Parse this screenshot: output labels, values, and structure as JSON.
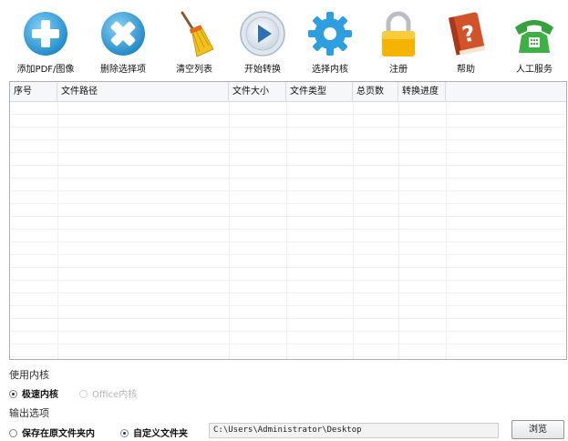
{
  "toolbar": {
    "buttons": [
      {
        "label": "添加PDF/图像",
        "icon": "add-icon"
      },
      {
        "label": "删除选择项",
        "icon": "delete-icon"
      },
      {
        "label": "清空列表",
        "icon": "broom-icon"
      },
      {
        "label": "开始转换",
        "icon": "play-icon"
      },
      {
        "label": "选择内核",
        "icon": "gear-icon"
      },
      {
        "label": "注册",
        "icon": "lock-icon"
      },
      {
        "label": "帮助",
        "icon": "help-book-icon"
      },
      {
        "label": "人工服务",
        "icon": "telephone-icon"
      }
    ]
  },
  "table": {
    "columns": [
      "序号",
      "文件路径",
      "文件大小",
      "文件类型",
      "总页数",
      "转换进度"
    ],
    "rows": []
  },
  "engine": {
    "title": "使用内核",
    "options": [
      {
        "label": "极速内核",
        "selected": true,
        "enabled": true
      },
      {
        "label": "Office内核",
        "selected": false,
        "enabled": false
      }
    ]
  },
  "output": {
    "title": "输出选项",
    "options": [
      {
        "label": "保存在原文件夹内",
        "selected": false
      },
      {
        "label": "自定义文件夹",
        "selected": true
      }
    ],
    "path_value": "C:\\Users\\Administrator\\Desktop",
    "browse_label": "浏览"
  },
  "colors": {
    "add": "#2aa0dc",
    "delete": "#2b9ad6",
    "play": "#2f6fb4",
    "gear": "#2f9ede",
    "lock": "#f4b400",
    "book": "#d2522a",
    "phone": "#36a23c"
  }
}
